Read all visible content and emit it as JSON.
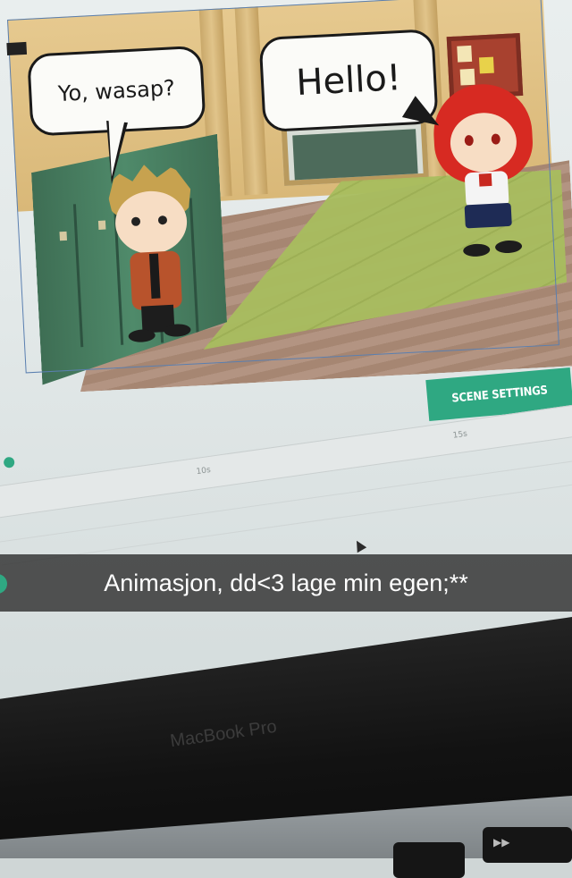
{
  "scene": {
    "bubbles": [
      {
        "id": "left",
        "text": "Yo, wasap?"
      },
      {
        "id": "right",
        "text": "Hello!"
      }
    ],
    "scene_settings_label": "SCENE SETTINGS"
  },
  "timeline": {
    "tick_labels": [
      "10s",
      "15s"
    ]
  },
  "caption": {
    "text": "Animasjon, dd<3 lage min egen;**"
  },
  "device": {
    "bezel_label": "MacBook Pro",
    "keys": [
      {
        "glyph": "",
        "icon": "blank-key"
      },
      {
        "glyph": "▶▶",
        "icon": "fast-forward-icon"
      }
    ]
  },
  "colors": {
    "accent": "#2fa882",
    "caption_bg": "#282828"
  }
}
